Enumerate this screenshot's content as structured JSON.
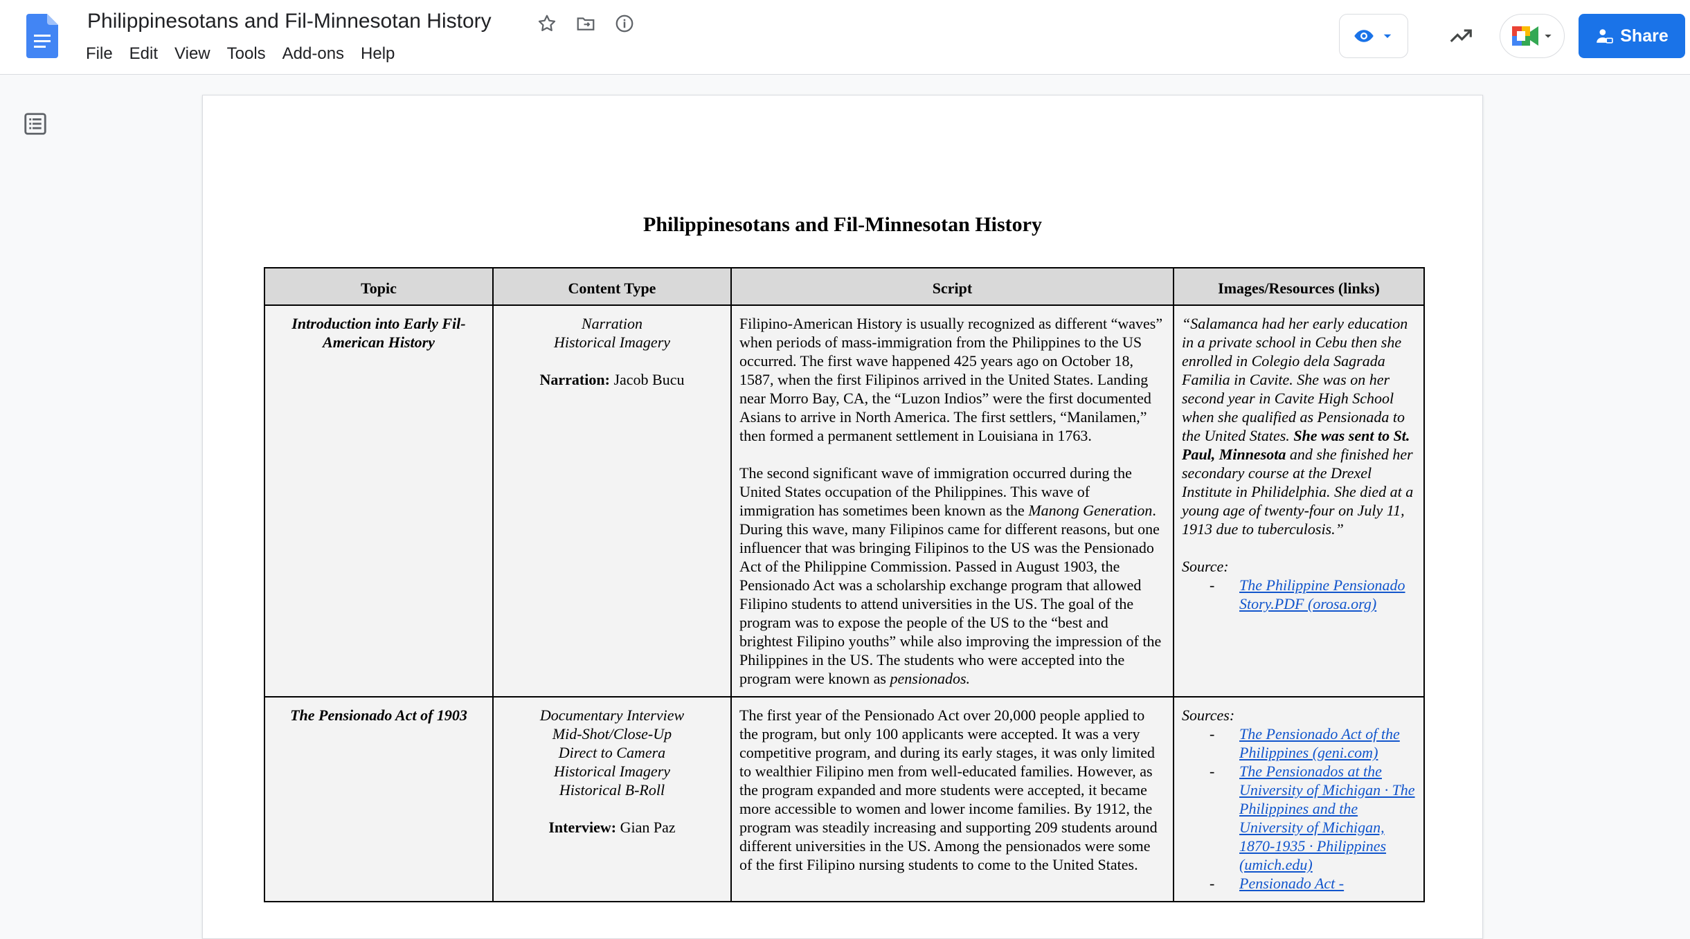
{
  "header": {
    "doc_title": "Philippinesotans and Fil-Minnesotan History",
    "menu": [
      "File",
      "Edit",
      "View",
      "Tools",
      "Add-ons",
      "Help"
    ],
    "share_label": "Share",
    "brand_color": "#1a73e8"
  },
  "icons": [
    "docs-logo-icon",
    "star-icon",
    "move-to-folder-icon",
    "info-icon",
    "eye-icon",
    "chevron-down-icon",
    "trending-up-icon",
    "meet-icon",
    "person-icon",
    "outline-icon"
  ],
  "document": {
    "title": "Philippinesotans and Fil-Minnesotan History",
    "table": {
      "headers": [
        "Topic",
        "Content Type",
        "Script",
        "Images/Resources (links)"
      ],
      "rows": [
        {
          "topic": "Introduction into Early Fil-American History",
          "content_types": [
            "Narration",
            "Historical Imagery"
          ],
          "credit_label": "Narration:",
          "credit_name": "Jacob Bucu",
          "script_p1": "Filipino-American History is usually recognized as different “waves” when periods of mass-immigration from the Philippines to the US occurred. The first wave happened 425 years ago on October 18, 1587, when the first Filipinos arrived in the United States. Landing near Morro Bay, CA, the “Luzon Indios” were the first documented Asians to arrive in North America. The first settlers, “Manilamen,” then formed a permanent settlement in Louisiana in 1763.",
          "script_p2_a": "The second significant wave of immigration occurred during the United States occupation of the Philippines. This wave of immigration has sometimes been known as the ",
          "script_p2_em": "Manong Generation",
          "script_p2_b": ". During this wave, many Filipinos came for different reasons, but one influencer that was bringing Filipinos to the US was the Pensionado Act of the Philippine Commission. Passed in August 1903, the Pensionado Act was a scholarship exchange program that allowed Filipino students to attend universities in the US. The goal of the program was to expose the people of the US to the “best and brightest Filipino youths” while also improving the impression of the Philippines in the US. The students who were accepted into the program were known as ",
          "script_p2_em2": "pensionados.",
          "quote_a": "“Salamanca had her early education in a private school in Cebu then she enrolled in Colegio dela Sagrada Familia in Cavite. She was on her second year in Cavite High School when she qualified as Pensionada to the United States. ",
          "quote_bold": "She was sent to St. Paul, Minnesota",
          "quote_b": " and she finished her secondary course at the Drexel Institute in Philidelphia. She died at a young age of twenty-four on July 11, 1913 due to tuberculosis.”",
          "source_label": "Source:",
          "links": [
            "The Philippine Pensionado Story.PDF (orosa.org)"
          ]
        },
        {
          "topic": "The Pensionado Act of 1903",
          "content_types": [
            "Documentary Interview",
            "Mid-Shot/Close-Up",
            "Direct to Camera",
            "Historical Imagery",
            "Historical B-Roll"
          ],
          "credit_label": "Interview:",
          "credit_name": "Gian Paz",
          "script_p1": "The first year of the Pensionado Act over 20,000 people applied to the program, but only 100 applicants were accepted. It was a very competitive program, and during its early stages, it was only limited to wealthier Filipino men from well-educated families. However, as the program expanded and more students were accepted, it became more accessible to women and lower income families. By 1912, the program was steadily increasing and supporting 209 students around different universities in the US. Among the pensionados were some of the first Filipino nursing students to come to the United States.",
          "source_label": "Sources:",
          "links": [
            "The Pensionado Act of the Philippines (geni.com)",
            "The Pensionados at the University of Michigan · The Philippines and the University of Michigan, 1870-1935 · Philippines (umich.edu)",
            "Pensionado Act -"
          ]
        }
      ]
    }
  }
}
